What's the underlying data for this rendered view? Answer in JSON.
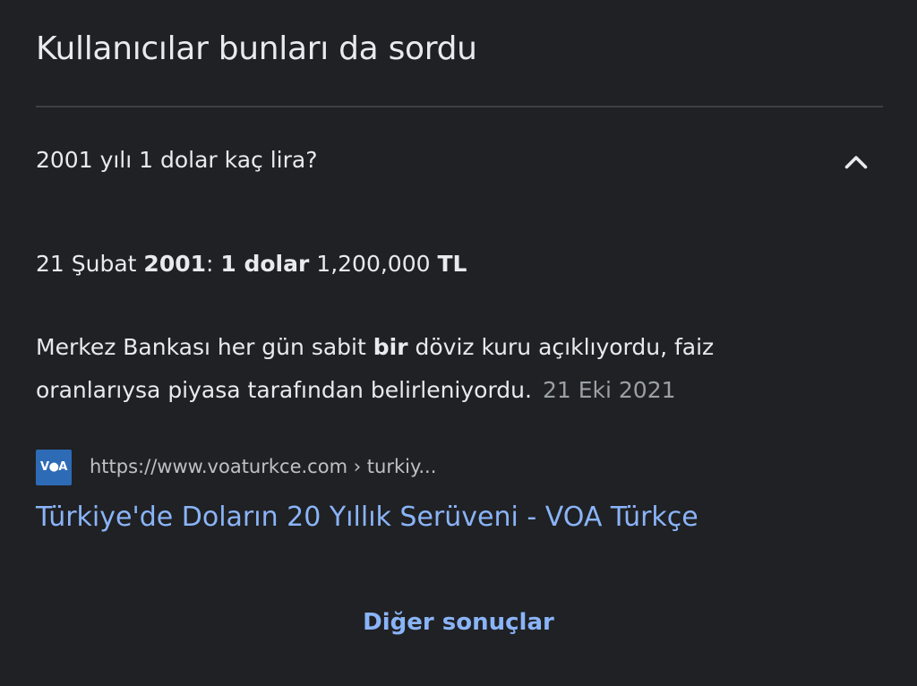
{
  "section": {
    "title": "Kullanıcılar bunları da sordu"
  },
  "question": {
    "text": "2001 yılı 1 dolar kaç lira?",
    "expanded": true,
    "icon": "chevron-up-icon"
  },
  "answer": {
    "date_prefix": "21 Şubat ",
    "year": "2001",
    "colon": ": ",
    "amount_label": "1 dolar",
    "value": " 1,200,000 ",
    "currency": "TL",
    "para_part1": "Merkez Bankası her gün sabit ",
    "para_bold": "bir",
    "para_part2": " döviz kuru açıklıyordu, faiz oranlarıysa piyasa tarafından belirleniyordu.",
    "published": "21 Eki 2021"
  },
  "source": {
    "favicon_text": "V●A",
    "url": "https://www.voaturkce.com › turkiy...",
    "title": "Türkiye'de Doların 20 Yıllık Serüveni - VOA Türkçe"
  },
  "footer": {
    "more_label": "Diğer sonuçlar"
  },
  "colors": {
    "background": "#202124",
    "text": "#e8eaed",
    "muted": "#9aa0a6",
    "link": "#8ab4f8",
    "divider": "#3c4043"
  }
}
